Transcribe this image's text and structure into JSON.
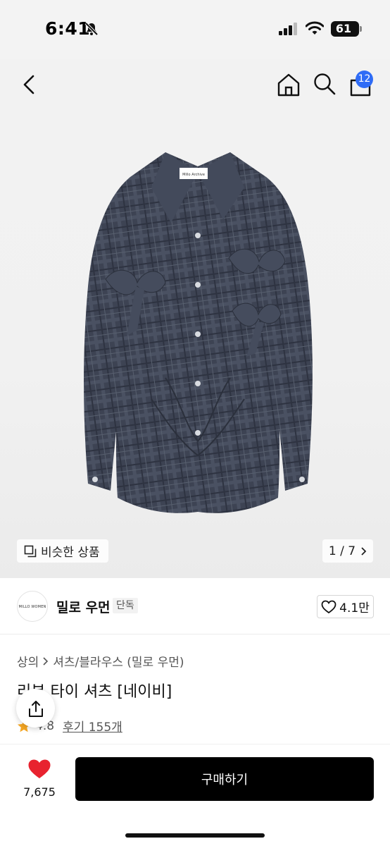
{
  "status_bar": {
    "time": "6:41",
    "battery": "61"
  },
  "nav": {
    "cart_badge": "12"
  },
  "hero": {
    "shirt_label": "Millo Archive",
    "similar_label": "비슷한 상품",
    "page_counter": "1 / 7"
  },
  "brand": {
    "logo_text": "MILLO WOMEN",
    "name": "밀로 우먼",
    "tag": "단독",
    "likes": "4.1만"
  },
  "product": {
    "breadcrumb": [
      "상의",
      "셔츠/블라우스 (밀로 우먼)"
    ],
    "title": "리본 타이 셔츠 [네이비]",
    "rating": "4.8",
    "reviews": "후기 155개"
  },
  "bottom_bar": {
    "heart_count": "7,675",
    "buy_label": "구매하기"
  },
  "colors": {
    "accent_blue": "#2f6cf6",
    "heart_red": "#e8232f",
    "star_orange": "#f5a623",
    "shirt_navy": "#3b4150"
  }
}
